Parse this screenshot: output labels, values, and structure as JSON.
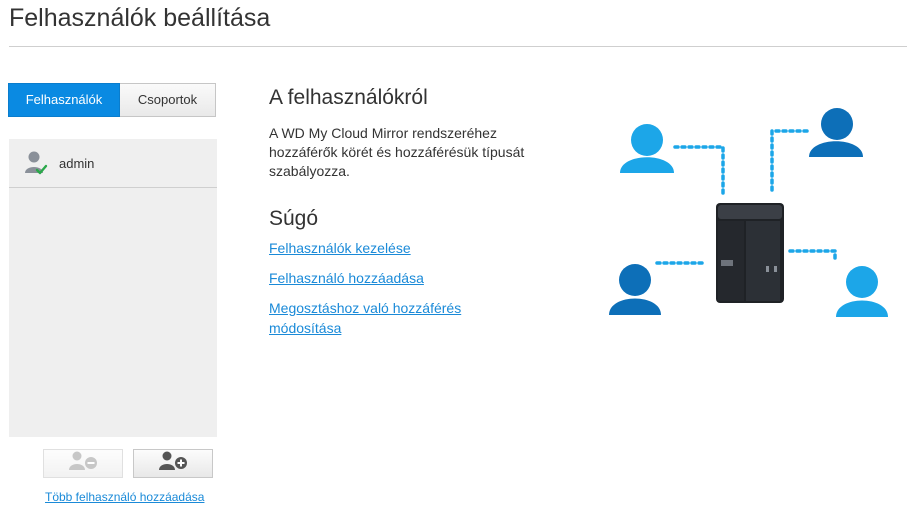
{
  "page": {
    "title": "Felhasználók beállítása"
  },
  "tabs": [
    {
      "label": "Felhasználók",
      "active": true
    },
    {
      "label": "Csoportok",
      "active": false
    }
  ],
  "users": [
    {
      "name": "admin",
      "icon": "user-check-icon"
    }
  ],
  "actions": {
    "remove_icon": "remove-user-icon",
    "add_icon": "add-user-icon",
    "more_link": "Több felhasználó hozzáadása"
  },
  "about": {
    "heading": "A felhasználókról",
    "text": "A WD My Cloud Mirror rendszeréhez hozzáférők körét és hozzáférésük típusát szabályozza."
  },
  "help": {
    "heading": "Súgó",
    "links": [
      "Felhasználók kezelése",
      "Felhasználó hozzáadása",
      "Megosztáshoz való hozzáférés módosítása"
    ]
  },
  "colors": {
    "accent": "#0a8ae2",
    "link": "#1a8ad8",
    "person_light": "#1ca6e8",
    "person_dark": "#0d6fb8",
    "device": "#2a2d33"
  }
}
